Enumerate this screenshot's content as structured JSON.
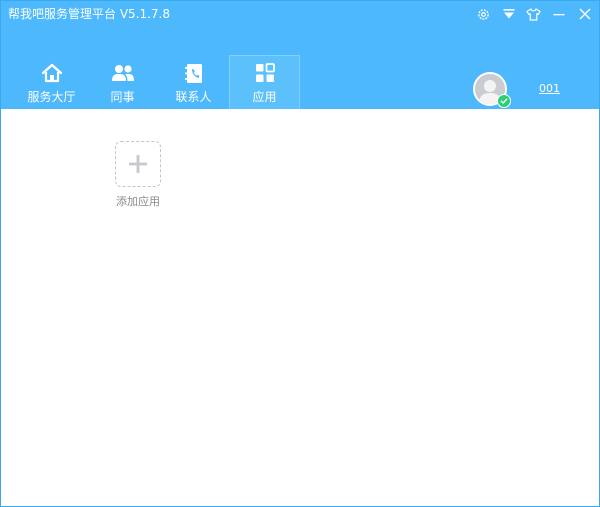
{
  "window": {
    "title": "帮我吧服务管理平台  V5.1.7.8",
    "controls": [
      {
        "name": "settings-icon"
      },
      {
        "name": "dropdown-menu-icon"
      },
      {
        "name": "skin-shirt-icon"
      },
      {
        "name": "minimize-icon"
      },
      {
        "name": "close-icon"
      }
    ]
  },
  "nav": {
    "tabs": [
      {
        "label": "服务大厅",
        "icon": "home-icon"
      },
      {
        "label": "同事",
        "icon": "colleagues-icon"
      },
      {
        "label": "联系人",
        "icon": "contacts-book-icon"
      },
      {
        "label": "应用",
        "icon": "apps-grid-icon",
        "active": true
      }
    ]
  },
  "user": {
    "name": "001",
    "status": "online",
    "avatar_icon": "avatar-icon",
    "status_icon": "online-check-icon"
  },
  "main": {
    "add_app_label": "添加应用",
    "add_icon": "plus-icon"
  },
  "colors": {
    "header_bg": "#4db8fb",
    "active_tab_bg": "#5cc0fb",
    "online_green": "#2ccf73"
  }
}
